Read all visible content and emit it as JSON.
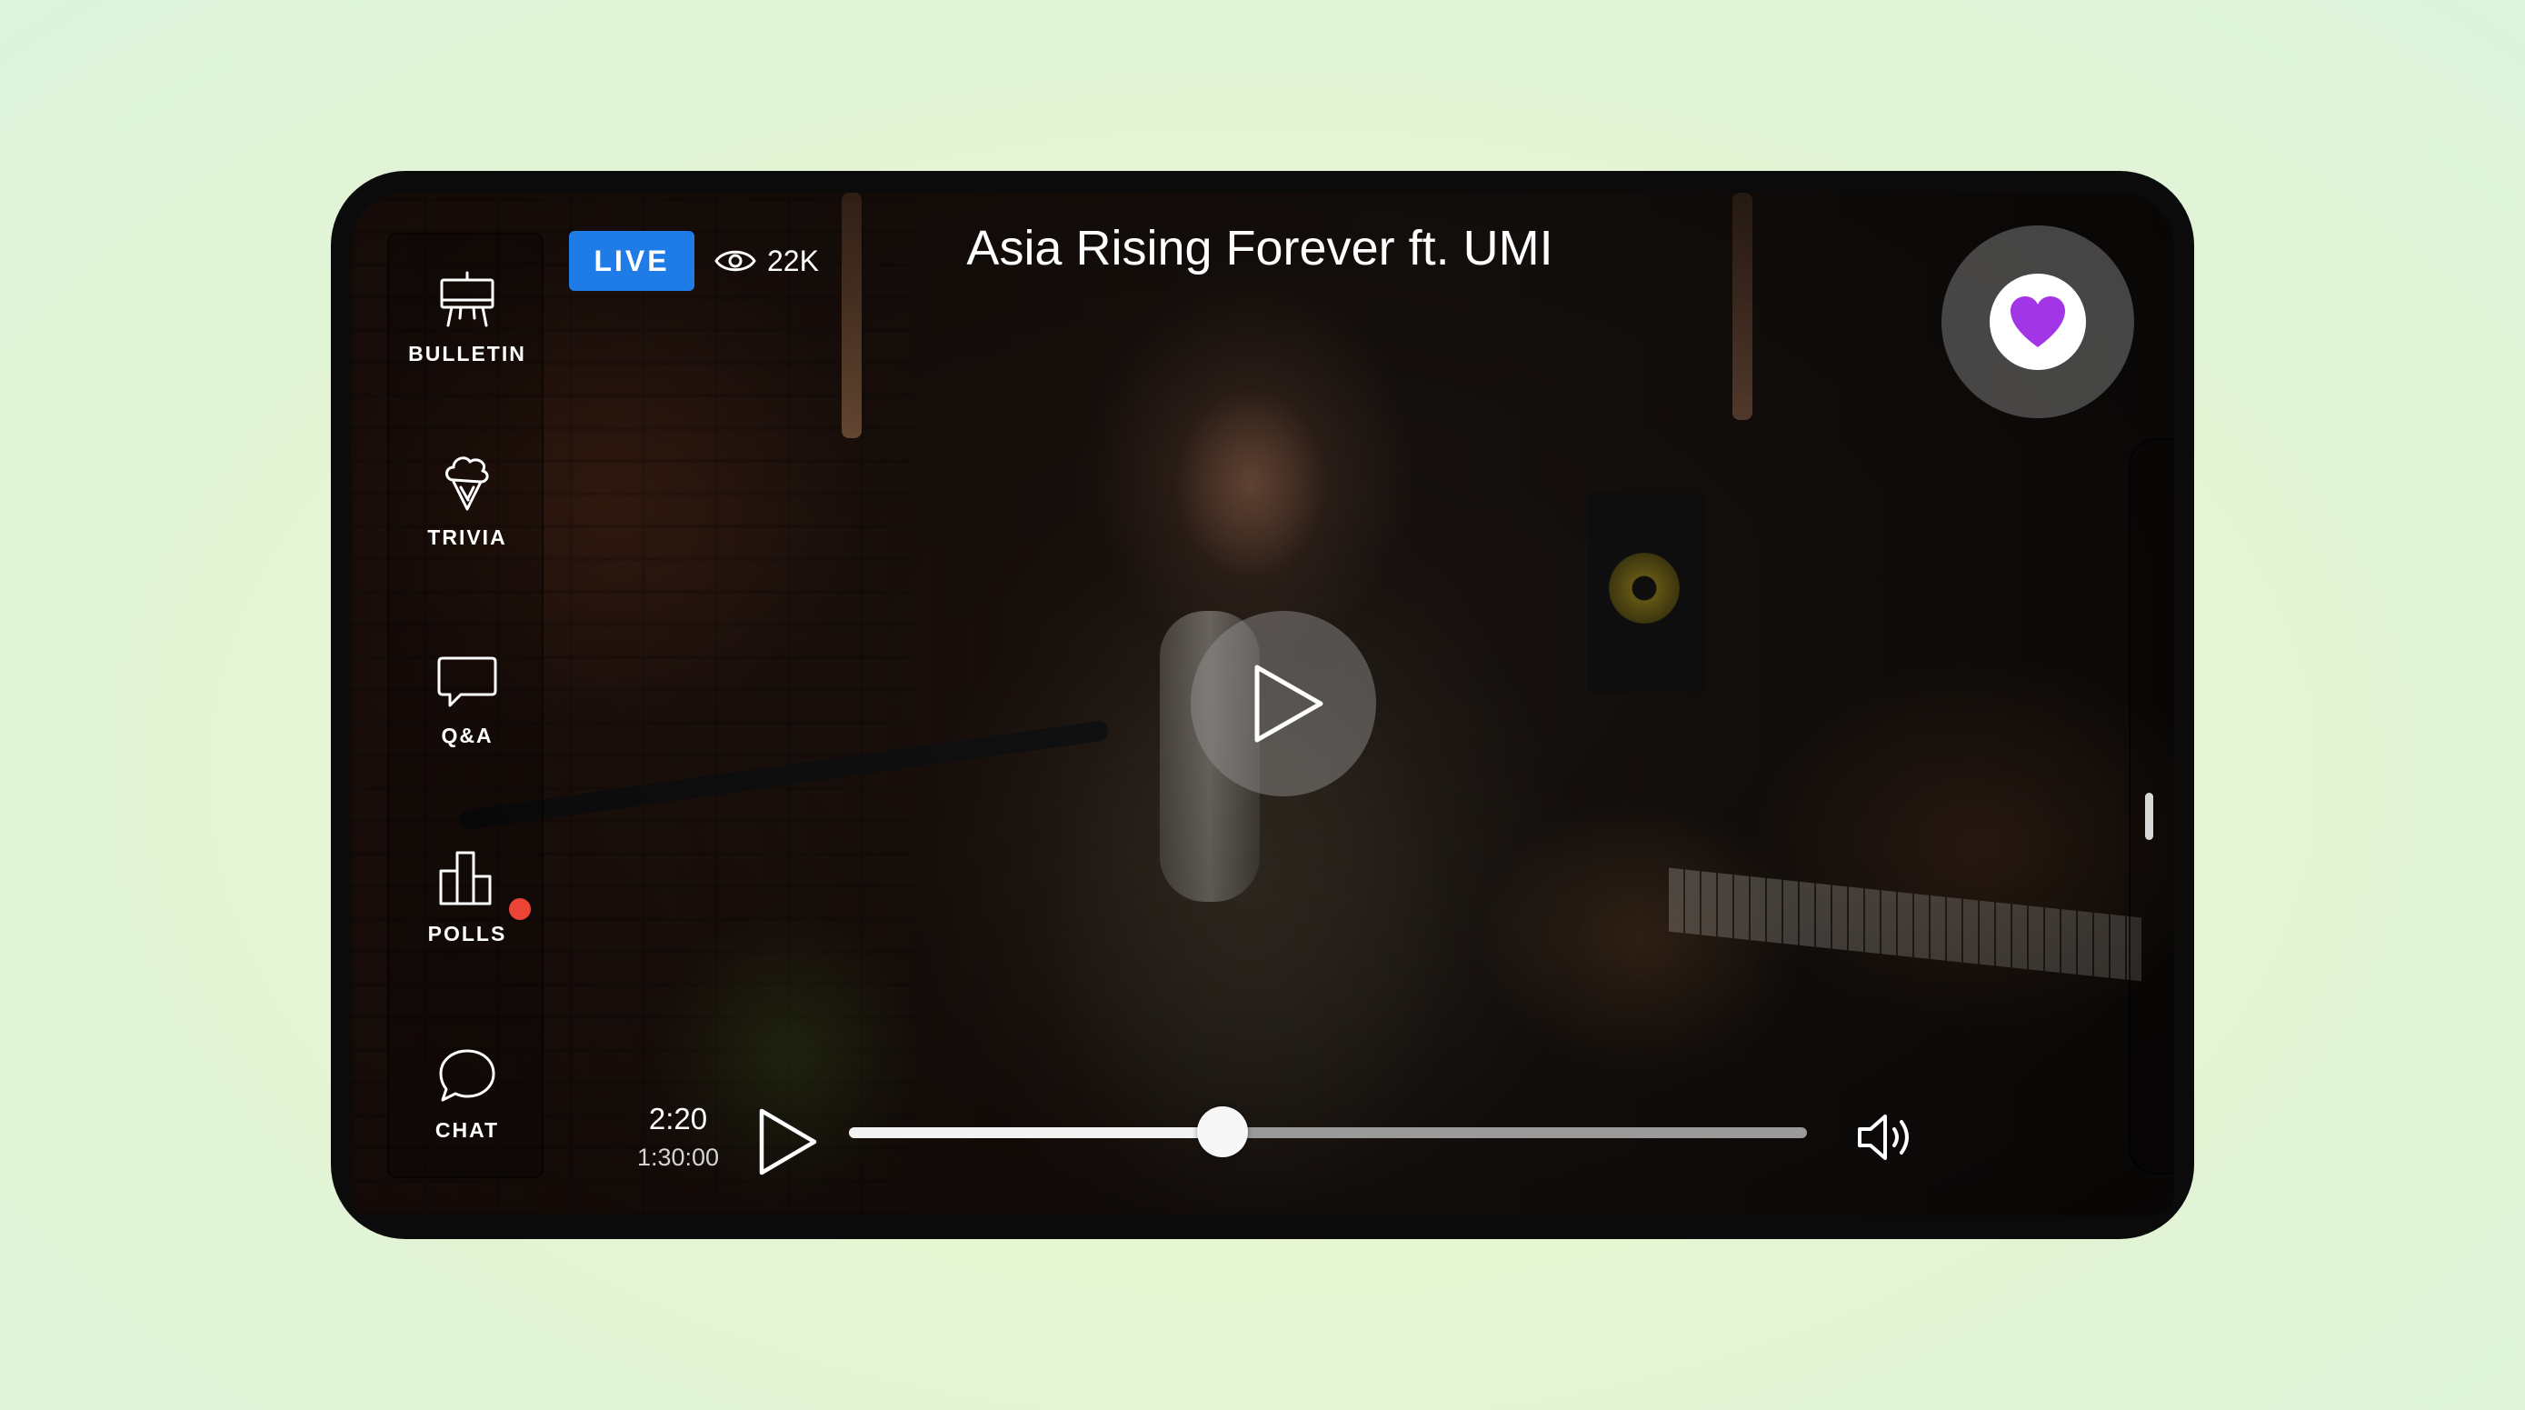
{
  "sidebar": {
    "items": [
      {
        "label": "BULLETIN",
        "icon": "easel-icon"
      },
      {
        "label": "TRIVIA",
        "icon": "ice-cream-icon"
      },
      {
        "label": "Q&A",
        "icon": "speech-bubble-icon"
      },
      {
        "label": "POLLS",
        "icon": "bar-chart-icon",
        "has_notification": true
      },
      {
        "label": "CHAT",
        "icon": "chat-bubble-icon"
      }
    ]
  },
  "header": {
    "live_label": "LIVE",
    "viewer_count": "22K",
    "title": "Asia Rising Forever ft. UMI"
  },
  "player": {
    "current_time": "2:20",
    "total_time": "1:30:00",
    "progress_fraction": 0.39
  },
  "colors": {
    "live_badge": "#1f7be5",
    "heart": "#a236e6",
    "notification_dot": "#ec4336"
  },
  "icons": {
    "favorite": "heart-icon",
    "center_play": "play-icon",
    "play": "play-icon",
    "volume": "speaker-volume-icon",
    "viewers": "eye-icon"
  }
}
